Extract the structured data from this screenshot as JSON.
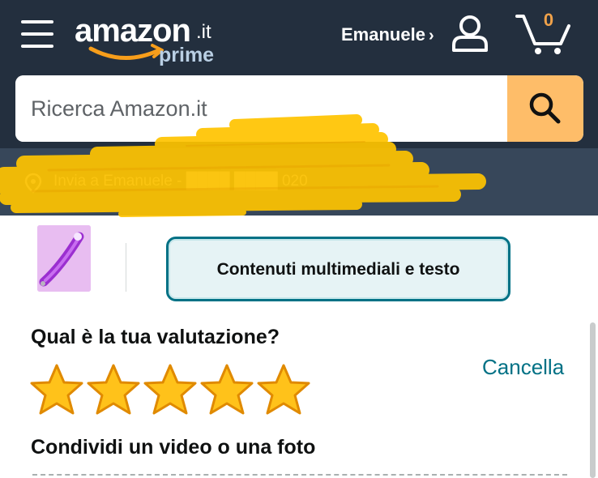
{
  "header": {
    "logo": {
      "wordmark": "amazon",
      "tld": ".it",
      "program": "prime"
    },
    "account_name": "Emanuele",
    "account_chevron": "›",
    "cart_count": "0"
  },
  "search": {
    "placeholder": "Ricerca Amazon.it",
    "button_icon": "search-icon"
  },
  "delivery": {
    "text": "Invia a Emanuele - ████ ████ 020",
    "icon": "location-pin-icon",
    "redacted": true
  },
  "review": {
    "media_button_label": "Contenuti multimediali e testo",
    "rating_question": "Qual è la tua valutazione?",
    "cancel_label": "Cancella",
    "rating": 5,
    "max_rating": 5,
    "share_title": "Condividi un video o una foto"
  },
  "colors": {
    "header_bg": "#232f3e",
    "delivery_bg": "#37475a",
    "search_button": "#febd69",
    "star_fill": "#ffc21a",
    "star_outline": "#e08a00",
    "link": "#007185",
    "cart_count": "#f0a24a",
    "redaction_scribble": "#ffc400"
  }
}
